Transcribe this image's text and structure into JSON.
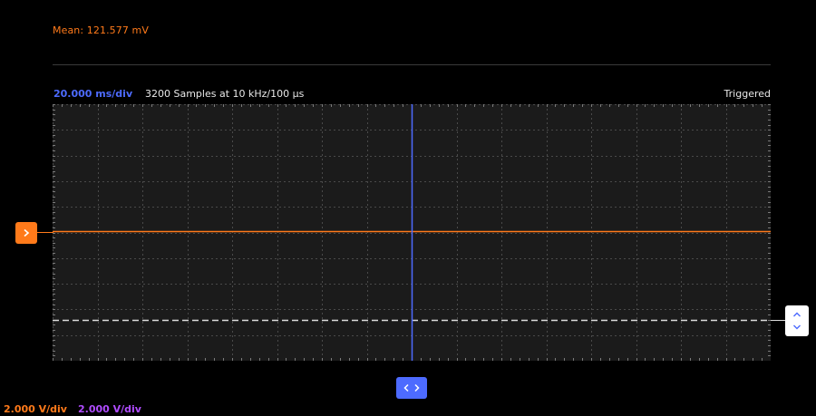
{
  "measurement": {
    "mean_label": "Mean: 121.577 mV"
  },
  "acquisition": {
    "timebase": "20.000 ms/div",
    "samples": "3200 Samples at 10 kHz/100 µs",
    "trigger_status": "Triggered"
  },
  "channels": {
    "ch1_scale": "2.000 V/div",
    "ch2_scale": "2.000 V/div"
  },
  "colors": {
    "ch1": "#ff7a1a",
    "ch2": "#b04cff",
    "timebase": "#4d6bff",
    "grid_background": "#1b1b1b",
    "trigger_level": "#dcdcdc"
  },
  "icons": {
    "ch1_marker": "chevron-right-icon",
    "trigger_level": "chevron-up-down-icon",
    "time_position": "chevron-left-right-icon"
  }
}
